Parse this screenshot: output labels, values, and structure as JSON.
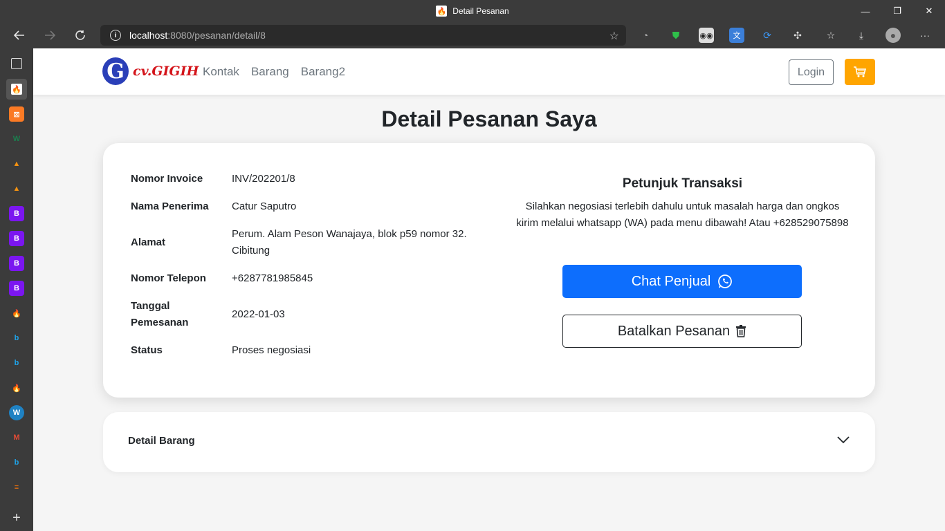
{
  "browser": {
    "window_title": "Detail Pesanan",
    "url_host": "localhost",
    "url_path": ":8080/pesanan/detail/8",
    "tab_icon": "fire-icon",
    "controls": {
      "minimize": "—",
      "restore": "❐",
      "close": "✕"
    }
  },
  "sidebar_icons": [
    "tabs-icon",
    "fire-icon",
    "xampp-icon",
    "w-icon",
    "pma-icon",
    "pma-icon",
    "bootstrap-icon",
    "bootstrap-icon",
    "bootstrap-icon",
    "bootstrap-icon",
    "fire-icon",
    "bing-icon",
    "bing-icon",
    "fire-icon",
    "wordpress-icon",
    "gmail-icon",
    "bing-icon",
    "stackoverflow-icon",
    "plus-icon"
  ],
  "navbar": {
    "logo_letter": "G",
    "logo_text": "cv.GIGIH",
    "links": [
      "Kontak",
      "Barang",
      "Barang2"
    ],
    "login_label": "Login",
    "cart_icon": "cart-icon"
  },
  "page_title": "Detail Pesanan Saya",
  "order": {
    "invoice_label": "Nomor Invoice",
    "invoice_value": "INV/202201/8",
    "recipient_label": "Nama Penerima",
    "recipient_value": "Catur Saputro",
    "address_label": "Alamat",
    "address_value": "Perum. Alam Peson Wanajaya, blok p59 nomor 32. Cibitung",
    "phone_label": "Nomor Telepon",
    "phone_value": "+6287781985845",
    "date_label": "Tanggal Pemesanan",
    "date_value": "2022-01-03",
    "status_label": "Status",
    "status_value": "Proses negosiasi"
  },
  "instructions": {
    "title": "Petunjuk Transaksi",
    "text": "Silahkan negosiasi terlebih dahulu untuk masalah harga dan ongkos kirim melalui whatsapp (WA) pada menu dibawah! Atau +628529075898",
    "chat_label": "Chat Penjual",
    "cancel_label": "Batalkan Pesanan"
  },
  "accordion": {
    "label": "Detail Barang"
  },
  "colors": {
    "primary": "#0d6efd",
    "cart": "#ffa500",
    "logo_blue": "#2a3fb8",
    "logo_red": "#d4141a"
  }
}
